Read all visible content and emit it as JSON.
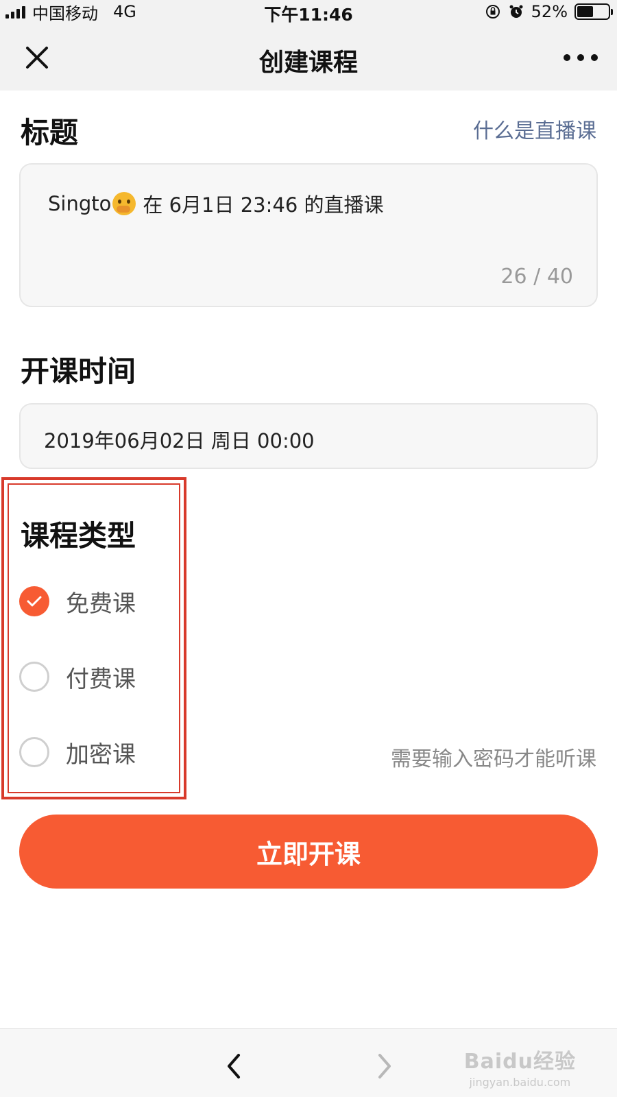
{
  "status_bar": {
    "carrier": "中国移动",
    "network": "4G",
    "time": "下午11:46",
    "battery_pct": "52%",
    "battery_level": 0.52
  },
  "nav": {
    "title": "创建课程",
    "close_icon": "close-icon",
    "more_icon": "more-icon"
  },
  "title_section": {
    "heading": "标题",
    "help_link": "什么是直播课",
    "author": "Singto",
    "emoji": "hand-over-mouth-emoji",
    "value_rest": "在 6月1日 23:46 的直播课",
    "counter": "26 / 40"
  },
  "time_section": {
    "heading": "开课时间",
    "value": "2019年06月02日 周日 00:00"
  },
  "type_section": {
    "heading": "课程类型",
    "options": [
      {
        "label": "免费课",
        "checked": true
      },
      {
        "label": "付费课",
        "checked": false
      },
      {
        "label": "加密课",
        "checked": false
      }
    ],
    "encrypted_hint": "需要输入密码才能听课"
  },
  "submit_label": "立即开课",
  "watermark": {
    "top": "Baidu经验",
    "bottom": "jingyan.baidu.com"
  },
  "colors": {
    "accent": "#f75b33",
    "highlight": "#d83a2b",
    "link": "#5a6d93"
  }
}
